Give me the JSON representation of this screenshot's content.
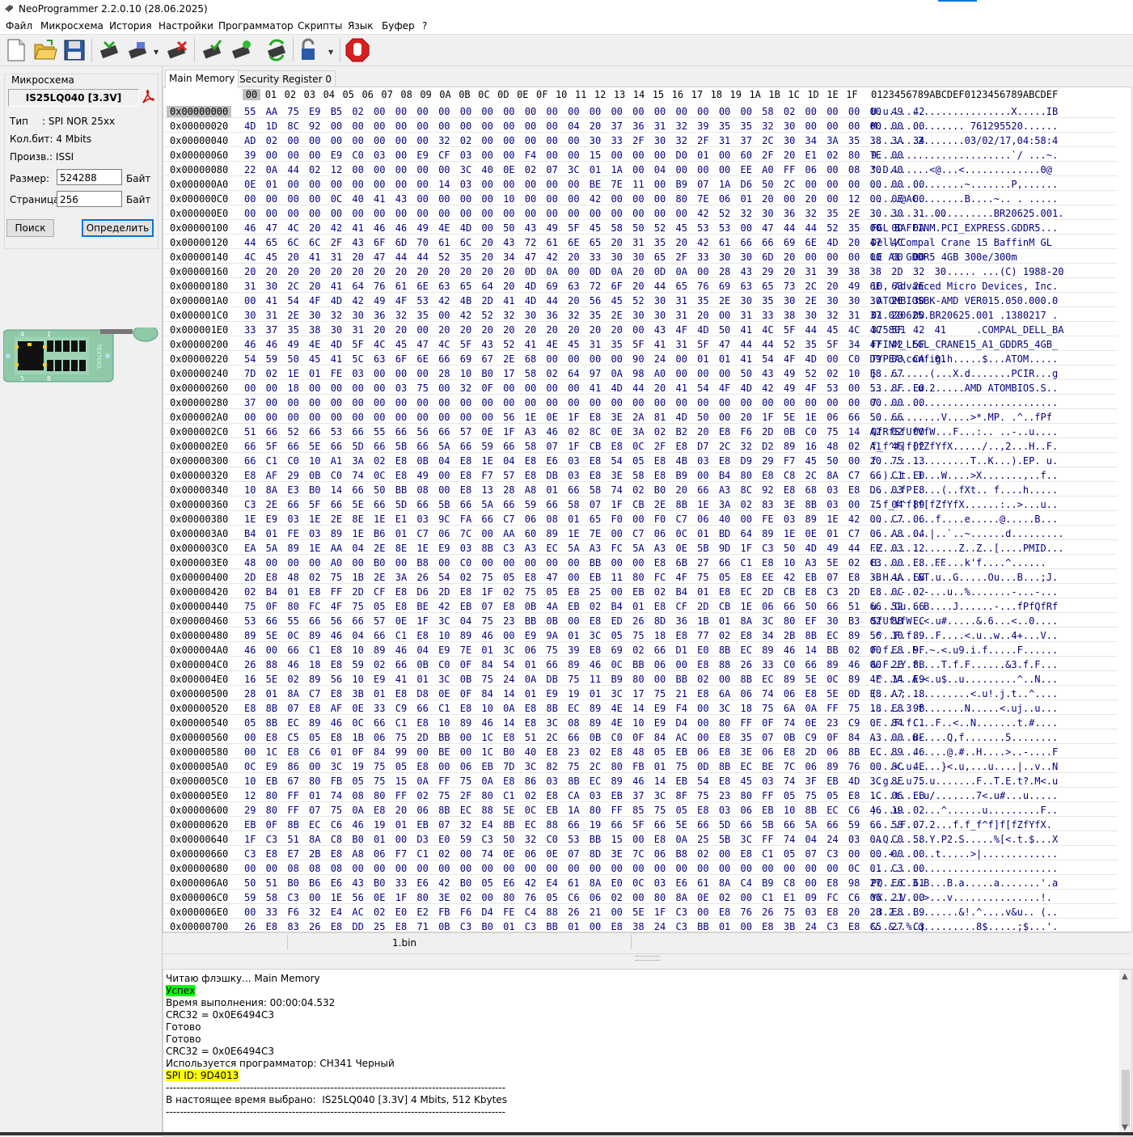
{
  "window": {
    "title": "NeoProgrammer 2.2.0.10 (28.06.2025)"
  },
  "menu": [
    "Файл",
    "Микросхема",
    "История",
    "Настройки",
    "Программатор",
    "Скрипты",
    "Язык",
    "Буфер",
    "?"
  ],
  "toolbar": {
    "icons": [
      "new-file-icon",
      "open-folder-icon",
      "save-icon",
      "read-chip-icon",
      "write-chip-icon",
      "erase-chip-icon",
      "verify-chip-icon",
      "blank-check-icon",
      "auto-icon",
      "unlock-icon",
      "stop-icon"
    ]
  },
  "chip_panel": {
    "group_title": "Микросхема",
    "chip_name": "IS25LQ040 [3.3V]",
    "type_label": "Тип",
    "type_value": ": SPI NOR 25xx",
    "bits_label": "Кол.бит: 4 Mbits",
    "manufacturer_label": "Произв.: ISSI",
    "size_label": "Размер:",
    "size_value": "524288",
    "size_unit": "Байт",
    "page_label": "Страница:",
    "page_value": "256",
    "page_unit": "Байт",
    "search_button": "Поиск",
    "detect_button": "Определить",
    "adapter_pins": [
      "4",
      "1",
      "5",
      "8"
    ],
    "adapter_text": "TEXTOOL"
  },
  "tabs": [
    "Main Memory",
    "Security Register 0"
  ],
  "hex": {
    "columns": [
      "00",
      "01",
      "02",
      "03",
      "04",
      "05",
      "06",
      "07",
      "08",
      "09",
      "0A",
      "0B",
      "0C",
      "0D",
      "0E",
      "0F",
      "10",
      "11",
      "12",
      "13",
      "14",
      "15",
      "16",
      "17",
      "18",
      "19",
      "1A",
      "1B",
      "1C",
      "1D",
      "1E",
      "1F"
    ],
    "ascii_header": "0123456789ABCDEF0123456789ABCDEF",
    "rows": [
      {
        "addr": "0x00000000",
        "bytes": "55 AA 75 E9 B5 02 00 00 00 00 00 00 00 00 00 00 00 00 00 00 00 00 00 00 58 02 00 00 00 00 49 42",
        "ascii": "U.u.....................X.....IB"
      },
      {
        "addr": "0x00000020",
        "bytes": "4D 1D 8C 92 00 00 00 00 00 00 00 00 00 00 00 04 20 37 36 31 32 39 35 35 32 30 00 00 00 00 00 00",
        "ascii": "M............... 761295520......"
      },
      {
        "addr": "0x00000040",
        "bytes": "AD 02 00 00 00 00 00 00 00 32 02 00 00 00 00 00 30 33 2F 30 32 2F 31 37 2C 30 34 3A 35 38 3A 34",
        "ascii": "........2.......03/02/17,04:58:4"
      },
      {
        "addr": "0x00000060",
        "bytes": "39 00 00 00 E9 C0 03 00 E9 CF 03 00 00 F4 00 00 15 00 00 00 D0 01 00 60 2F 20 E1 02 80 7E 00",
        "ascii": "9.......................`/ ...~."
      },
      {
        "addr": "0x00000080",
        "bytes": "22 0A 44 02 12 00 00 00 00 00 3C 40 0E 02 07 3C 01 1A 00 04 00 00 00 EE A0 FF 06 00 08 30 40",
        "ascii": "\".D.......<@...<.............0@"
      },
      {
        "addr": "0x000000A0",
        "bytes": "0E 01 00 00 00 00 00 00 00 14 03 00 00 00 00 00 BE 7E 11 00 B9 07 1A D6 50 2C 00 00 00 00 00 00",
        "ascii": "................~.......P,......"
      },
      {
        "addr": "0x000000C0",
        "bytes": "00 00 00 00 0C 40 41 43 00 00 00 00 10 00 00 00 42 00 00 00 80 7E 06 01 20 00 20 00 12 00 0E 00",
        "ascii": ".....@AC........B....~.. . ....."
      },
      {
        "addr": "0x000000E0",
        "bytes": "00 00 00 00 00 00 00 00 00 00 00 00 00 00 00 00 00 00 00 00 00 42 52 32 30 36 32 35 2E 30 30 31 00",
        "ascii": ".....................BR20625.001."
      },
      {
        "addr": "0x00000100",
        "bytes": "46 47 4C 20 42 41 46 46 49 4E 4D 00 50 43 49 5F 45 58 50 52 45 53 53 00 47 44 44 52 35 00 0D 0A",
        "ascii": "FGL BAFFINM.PCI_EXPRESS.GDDR5..."
      },
      {
        "addr": "0x00000120",
        "bytes": "44 65 6C 6C 2F 43 6F 6D 70 61 6C 20 43 72 61 6E 65 20 31 35 20 42 61 66 66 69 6E 4D 20 47 4C",
        "ascii": "Dell/Compal Crane 15 BaffinM GL"
      },
      {
        "addr": "0x00000140",
        "bytes": "4C 45 20 41 31 20 47 44 44 52 35 20 34 47 42 20 33 30 30 65 2F 33 30 30 6D 20 00 00 00 00 00 00",
        "ascii": "LE A1 GDDR5 4GB 300e/300m"
      },
      {
        "addr": "0x00000160",
        "bytes": "20 20 20 20 20 20 20 20 20 20 20 20 20 0D 0A 00 0D 0A 20 0D 0A 00 28 43 29 20 31 39 38 38 2D 32 30",
        "ascii": "             ..... ...(C) 1988-20"
      },
      {
        "addr": "0x00000180",
        "bytes": "31 30 2C 20 41 64 76 61 6E 63 65 64 20 4D 69 63 72 6F 20 44 65 76 69 63 65 73 2C 20 49 6E 63 2E",
        "ascii": "10, Advanced Micro Devices, Inc."
      },
      {
        "addr": "0x000001A0",
        "bytes": "00 41 54 4F 4D 42 49 4F 53 42 4B 2D 41 4D 44 20 56 45 52 30 31 35 2E 30 35 30 2E 30 30 30 2E 30",
        "ascii": ".ATOMBIOSBK-AMD VER015.050.000.0"
      },
      {
        "addr": "0x000001C0",
        "bytes": "30 31 2E 30 32 30 36 32 35 00 42 52 32 30 36 32 35 2E 30 30 31 20 00 31 33 38 30 32 31 37 20 00",
        "ascii": "01.020625.BR20625.001 .1380217 ."
      },
      {
        "addr": "0x000001E0",
        "bytes": "33 37 35 38 30 31 20 20 00 20 20 20 20 20 20 20 20 20 00 43 4F 4D 50 41 4C 5F 44 45 4C 4C 5F 42 41",
        "ascii": "375801  .         .COMPAL_DELL_BA"
      },
      {
        "addr": "0x00000200",
        "bytes": "46 46 49 4E 4D 5F 4C 45 47 4C 5F 43 52 41 4E 45 31 35 5F 41 31 5F 47 44 44 52 35 5F 34 47 42 5F",
        "ascii": "FFINM_LEGL_CRANE15_A1_GDDR5_4GB_"
      },
      {
        "addr": "0x00000220",
        "bytes": "54 59 50 45 41 5C 63 6F 6E 66 69 67 2E 68 00 00 00 00 90 24 00 01 01 41 54 4F 4D 00 C0 D9 03 CA 01",
        "ascii": "TYPEA\\config.h.....$...ATOM....."
      },
      {
        "addr": "0x00000240",
        "bytes": "7D 02 1E 01 FE 03 00 00 00 28 10 B0 17 58 02 64 97 0A 98 A0 00 00 00 50 43 49 52 02 10 E8 67",
        "ascii": "}.........(...X.d.......PCIR...g"
      },
      {
        "addr": "0x00000260",
        "bytes": "00 00 18 00 00 00 00 03 75 00 32 0F 00 00 00 00 41 4D 44 20 41 54 4F 4D 42 49 4F 53 00 53 8F E0",
        "ascii": "........u.2.....AMD ATOMBIOS.S.."
      },
      {
        "addr": "0x00000280",
        "bytes": "37 00 00 00 00 00 00 00 00 00 00 00 00 00 00 00 00 00 00 00 00 00 00 00 00 00 00 00 00 00 00 00",
        "ascii": "7..............................."
      },
      {
        "addr": "0x000002A0",
        "bytes": "00 00 00 00 00 00 00 00 00 00 00 00 56 1E 0E 1F E8 3E 2A 81 4D 50 00 20 1F 5E 1E 06 66 50 66",
        "ascii": "............V....>*.MP. .^..fPf"
      },
      {
        "addr": "0x000002C0",
        "bytes": "51 66 52 66 53 66 55 66 56 66 57 0E 1F A3 46 02 8C 0E 3A 02 B2 20 E8 F6 2D 0B C0 75 14 A2 02 00",
        "ascii": "QfRfSfUfVfW...F...:.. ..-..u...."
      },
      {
        "addr": "0x000002E0",
        "bytes": "66 5F 66 5E 66 5D 66 5B 66 5A 66 59 66 58 07 1F CB E8 0C 2F E8 D7 2C 32 D2 89 16 48 02 A1 46 02",
        "ascii": "f_f^f]f[fZfYfX...../..,2...H..F."
      },
      {
        "addr": "0x00000300",
        "bytes": "66 C1 C0 10 A1 3A 02 E8 0B 04 E8 1E 04 E8 E6 03 E8 54 05 E8 4B 03 E8 D9 29 F7 45 50 00 20 75 13",
        "ascii": "f....:...........T..K...).EP. u."
      },
      {
        "addr": "0x00000320",
        "bytes": "E8 AF 29 0B C0 74 0C E8 49 00 E8 F7 57 E8 DB 03 E8 3E 58 E8 B9 00 B4 80 E8 C8 2C 8A C7 66 C1 E0",
        "ascii": "..)..t..I...W....>X.......,..f.."
      },
      {
        "addr": "0x00000340",
        "bytes": "10 8A E3 B0 14 66 50 BB 08 00 E8 13 28 A8 01 66 58 74 02 B0 20 66 A3 8C 92 E8 68 03 E8 D6 03 E8",
        "ascii": ".....fP.....(..fXt.. f....h....."
      },
      {
        "addr": "0x00000360",
        "bytes": "C3 2E 66 5F 66 5E 66 5D 66 5B 66 5A 66 59 66 58 07 1F CB 2E 8B 1E 3A 02 83 3E 8B 03 00 75 04 89",
        "ascii": "..f_f^f]f[fZfYfX......:..>...u.."
      },
      {
        "addr": "0x00000380",
        "bytes": "1E E9 03 1E 2E 8E 1E E1 03 9C FA 66 C7 06 08 01 65 F0 00 F0 C7 06 40 00 FE 03 89 1E 42 00 C7 06",
        "ascii": "...........f....e.....@.....B..."
      },
      {
        "addr": "0x000003A0",
        "bytes": "B4 01 FE 03 89 1E B6 01 C7 06 7C 00 AA 60 89 1E 7E 00 C7 06 0C 01 BD 64 89 1E 0E 01 C7 06 A8 04",
        "ascii": "..........|..`..~......d........."
      },
      {
        "addr": "0x000003C0",
        "bytes": "EA 5A 89 1E AA 04 2E 8E 1E E9 03 8B C3 A3 EC 5A A3 FC 5A A3 0E 5B 9D 1F C3 50 4D 49 44 FE 03 12",
        "ascii": ".Z.............Z..Z..[....PMID..."
      },
      {
        "addr": "0x000003E0",
        "bytes": "48 00 00 00 A0 00 B0 00 B8 00 C0 00 00 00 00 00 BB 00 00 E8 6B 27 66 C1 E8 10 A3 5E 02 C3 00 E8 FF",
        "ascii": "H...............k'f....^......"
      },
      {
        "addr": "0x00000400",
        "bytes": "2D E8 48 02 75 1B 2E 3A 26 54 02 75 05 E8 47 00 EB 11 80 FC 4F 75 05 E8 EE 42 EB 07 E8 3B 4A EB",
        "ascii": "-.H.u..:&T.u..G.....Ou...B...;J."
      },
      {
        "addr": "0x00000420",
        "bytes": "02 B4 01 E8 FF 2D CF E8 D6 2D E8 1F 02 75 05 E8 25 00 EB 02 B4 01 E8 EC 2D CB E8 C3 2D E8 0C 02",
        "ascii": ".....-...-...u..%.......-...-..."
      },
      {
        "addr": "0x00000440",
        "bytes": "75 0F 80 FC 4F 75 05 E8 BE 42 EB 07 E8 0B 4A EB 02 B4 01 E8 CF 2D CB 1E 06 66 50 66 51 66 52 66",
        "ascii": "u...Ou...B....J......-...fPfQfRf"
      },
      {
        "addr": "0x00000460",
        "bytes": "53 66 55 66 56 66 57 0E 1F 3C 04 75 23 BB 0B 00 E8 ED 26 8D 36 1B 01 8A 3C 80 EF 30 B3 02 8B EC",
        "ascii": "SfUfVfW..<.u#.....&.6...<..0...."
      },
      {
        "addr": "0x00000480",
        "bytes": "89 5E 0C 89 46 04 66 C1 E8 10 89 46 00 E9 9A 01 3C 05 75 18 E8 77 02 E8 34 2B 8B EC 89 56 10 89",
        "ascii": ".^..F.f....F....<.u..w..4+...V.."
      },
      {
        "addr": "0x000004A0",
        "bytes": "46 00 66 C1 E8 10 89 46 04 E9 7E 01 3C 06 75 39 E8 69 02 66 D1 E0 8B EC 89 46 14 BB 02 00 E8 9F",
        "ascii": "F.f....F..~.<.u9.i.f.....F......"
      },
      {
        "addr": "0x000004C0",
        "bytes": "26 88 46 18 E8 59 02 66 0B C0 0F 84 54 01 66 89 46 0C BB 06 00 E8 88 26 33 C0 66 89 46 00 2E 8B",
        "ascii": "&.F..Y.f....T.f.F......&3.f.F..."
      },
      {
        "addr": "0x000004E0",
        "bytes": "16 5E 02 89 56 10 E9 41 01 3C 0B 75 24 0A DB 75 11 B9 80 00 BB 02 00 8B EC 89 5E 0C 89 4E 14 E9",
        "ascii": ".^..V..A.<.u$..u.........^..N..."
      },
      {
        "addr": "0x00000500",
        "bytes": "28 01 8A C7 E8 3B 01 E8 D8 0E 0F 84 14 01 E9 19 01 3C 17 75 21 E8 6A 06 74 06 E8 5E 0D E8 A7 18",
        "ascii": "(....;...........<.u!.j.t..^...."
      },
      {
        "addr": "0x00000520",
        "bytes": "E8 8B 07 E8 AF 0E 33 C9 66 C1 E8 10 0A E8 8B EC 89 4E 14 E9 F4 00 3C 18 75 6A 0A FF 75 18 E8 9B",
        "ascii": "......3.f.......N.....<.uj..u..."
      },
      {
        "addr": "0x00000540",
        "bytes": "05 8B EC 89 46 0C 66 C1 E8 10 89 46 14 E8 3C 08 89 4E 10 E9 D4 00 80 FF 0F 74 0E 23 C9 0F 84 C1",
        "ascii": "....F.f....F..<..N.......t.#...."
      },
      {
        "addr": "0x00000560",
        "bytes": "00 E8 C5 05 E8 1B 06 75 2D BB 00 1C E8 51 2C 66 0B C0 0F 84 AC 00 E8 35 07 0B C9 0F 84 A3 00 BE",
        "ascii": ".......u-....Q,f.......5........"
      },
      {
        "addr": "0x00000580",
        "bytes": "00 1C E8 C6 01 0F 84 99 00 BE 00 1C B0 40 E8 23 02 E8 48 05 EB 06 E8 3E 06 E8 2D 06 8B EC 89 46",
        "ascii": ".............@.#..H....>..-....F"
      },
      {
        "addr": "0x000005A0",
        "bytes": "0C E9 86 00 3C 19 75 05 E8 00 06 EB 7D 3C 82 75 2C 80 FB 01 75 0D 8B EC BE 7C 06 89 76 00 8C 4E",
        "ascii": "....<.u.....}<.u,...u....|..v..N"
      },
      {
        "addr": "0x000005C0",
        "bytes": "10 EB 67 80 FB 05 75 15 0A FF 75 0A E8 86 03 8B EC 89 46 14 EB 54 E8 45 03 74 3F EB 4D 3C 8E 75",
        "ascii": "..g...u...u.......F..T.E.t?.M<.u"
      },
      {
        "addr": "0x000005E0",
        "bytes": "12 80 FF 01 74 08 80 FF 02 75 2F 80 C1 02 E8 CA 03 EB 37 3C 8F 75 23 80 FF 05 75 05 E8 1C 06 EB",
        "ascii": "....t....u/.......7<.u#...u....."
      },
      {
        "addr": "0x00000600",
        "bytes": "29 80 FF 07 75 0A E8 20 06 8B EC 88 5E 0C EB 1A 80 FF 85 75 05 E8 03 06 EB 10 8B EC C6 46 19 02",
        "ascii": ")...u.. ....^......u.........F.."
      },
      {
        "addr": "0x00000620",
        "bytes": "EB 0F 8B EC C6 46 19 01 EB 07 32 E4 8B EC 88 66 19 66 5F 66 5E 66 5D 66 5B 66 5A 66 59 66 58 07",
        "ascii": ".....F....2...f.f_f^f]f[fZfYfX."
      },
      {
        "addr": "0x00000640",
        "bytes": "1F C3 51 8A C8 B0 01 00 D3 E0 59 C3 50 32 C0 53 BB 15 00 E8 0A 25 5B 3C FF 74 04 24 03 0A C0 58",
        "ascii": "..Q.......Y.P2.S.....%[<.t.$...X"
      },
      {
        "addr": "0x00000660",
        "bytes": "C3 E8 E7 2B E8 A8 06 F7 C1 02 00 74 0E 06 0E 07 8D 3E 7C 06 B8 02 00 E8 C1 05 07 C3 00 00 00 00",
        "ascii": "...+.......t.....>|............."
      },
      {
        "addr": "0x00000680",
        "bytes": "00 00 08 08 08 00 00 00 00 00 00 00 00 00 00 00 00 00 00 00 00 00 00 00 00 00 00 00 0C 01 C3 00",
        "ascii": "................................"
      },
      {
        "addr": "0x000006A0",
        "bytes": "50 51 B0 B6 E6 43 B0 33 E6 42 B0 05 E6 42 E4 61 8A E0 0C 03 E6 61 8A C4 B9 C8 00 E8 98 27 E6 61",
        "ascii": "PQ...C.3.B...B.a.....a.......'.a"
      },
      {
        "addr": "0x000006C0",
        "bytes": "59 58 C3 00 1E 56 0E 1F 80 3E 02 00 80 76 05 C6 06 02 00 80 8A 0E 02 00 C1 E1 09 FC C6 06 21 00",
        "ascii": "YX...V...>...v...............!."
      },
      {
        "addr": "0x000006E0",
        "bytes": "00 33 F6 32 E4 AC 02 E0 E2 FB F6 D4 FE C4 88 26 21 00 5E 1F C3 00 E8 76 26 75 03 E8 20 28 E8 B9",
        "ascii": ".3.2...........&!.^....v&u.. (.."
      },
      {
        "addr": "0x00000700",
        "bytes": "26 E8 83 26 E8 DD 25 E8 71 0B C3 B0 01 C3 BB 01 00 E8 38 24 C3 BB 01 00 E8 3B 24 C3 E8 C5 27 C3",
        "ascii": "&..&..%.q.........8$.....;$...'."
      }
    ]
  },
  "status_file": "1.bin",
  "log": [
    {
      "text": "Читаю флэшку... Main Memory",
      "hl": ""
    },
    {
      "text": "Успех",
      "hl": "green"
    },
    {
      "text": "Время выполнения: 00:00:04.532",
      "hl": ""
    },
    {
      "text": "CRC32 = 0x0E6494C3",
      "hl": ""
    },
    {
      "text": "Готово",
      "hl": ""
    },
    {
      "text": "Готово",
      "hl": ""
    },
    {
      "text": "CRC32 = 0x0E6494C3",
      "hl": ""
    },
    {
      "text": "Используется программатор: CH341 Черный",
      "hl": ""
    },
    {
      "text": "SPI ID: 9D4013",
      "hl": "yellow"
    },
    {
      "text": "-------------------------------------------------------------------------------------------------",
      "hl": ""
    },
    {
      "text": "В настоящее время выбрано:  IS25LQ040 [3.3V] 4 Mbits, 512 Kbytes",
      "hl": ""
    },
    {
      "text": "-------------------------------------------------------------------------------------------------",
      "hl": ""
    }
  ]
}
